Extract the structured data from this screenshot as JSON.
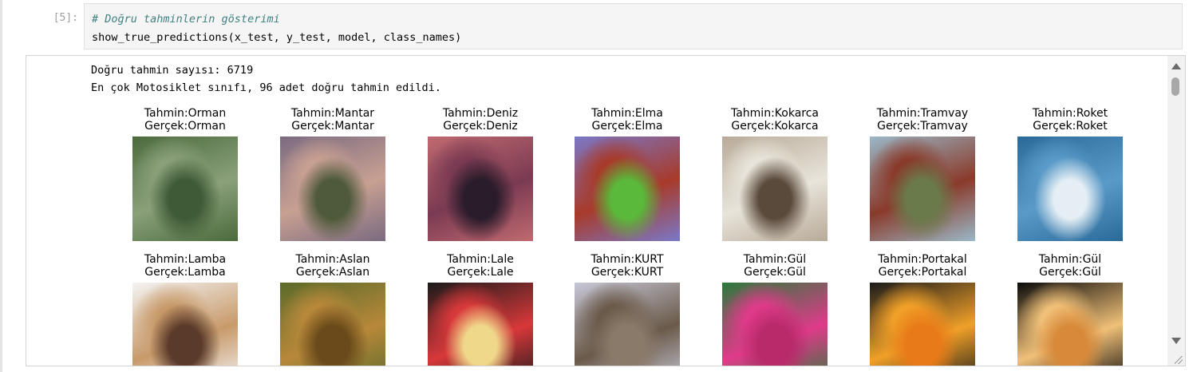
{
  "cell": {
    "prompt": "[5]:",
    "code_comment": "# Doğru tahminlerin gösterimi",
    "code_call": "show_true_predictions(x_test, y_test, model, class_names)"
  },
  "output": {
    "line1": "Doğru tahmin sayısı: 6719",
    "line2": "En çok Motosiklet sınıfı, 96 adet doğru tahmin edildi."
  },
  "predictions": [
    {
      "pred": "Tahmin:Orman",
      "true": "Gerçek:Orman",
      "colors": [
        "#4a6a3c",
        "#8aa07a",
        "#3e5a36"
      ]
    },
    {
      "pred": "Tahmin:Mantar",
      "true": "Gerçek:Mantar",
      "colors": [
        "#7a6a80",
        "#c8a092",
        "#4e5a3a"
      ]
    },
    {
      "pred": "Tahmin:Deniz",
      "true": "Gerçek:Deniz",
      "colors": [
        "#c06a70",
        "#7a3a52",
        "#2a1c2a"
      ]
    },
    {
      "pred": "Tahmin:Elma",
      "true": "Gerçek:Elma",
      "colors": [
        "#7a78c8",
        "#a83a2a",
        "#5ab83a"
      ]
    },
    {
      "pred": "Tahmin:Kokarca",
      "true": "Gerçek:Kokarca",
      "colors": [
        "#b8aa98",
        "#e8e4da",
        "#5a4a3c"
      ]
    },
    {
      "pred": "Tahmin:Tramvay",
      "true": "Gerçek:Tramvay",
      "colors": [
        "#9ab8c8",
        "#8a3a2a",
        "#6a7a4a"
      ]
    },
    {
      "pred": "Tahmin:Roket",
      "true": "Gerçek:Roket",
      "colors": [
        "#2a6a98",
        "#5a9ac8",
        "#e4eef4"
      ]
    },
    {
      "pred": "Tahmin:Lamba",
      "true": "Gerçek:Lamba",
      "colors": [
        "#f4f4f4",
        "#c89a6a",
        "#5a3a2a"
      ]
    },
    {
      "pred": "Tahmin:Aslan",
      "true": "Gerçek:Aslan",
      "colors": [
        "#5a6a2a",
        "#b8883a",
        "#6a4a1a"
      ]
    },
    {
      "pred": "Tahmin:Lale",
      "true": "Gerçek:Lale",
      "colors": [
        "#1a1a1a",
        "#d8383a",
        "#f0d88a"
      ]
    },
    {
      "pred": "Tahmin:KURT",
      "true": "Gerçek:KURT",
      "colors": [
        "#c8c8d8",
        "#6a5a4a",
        "#8a7a6a"
      ]
    },
    {
      "pred": "Tahmin:Gül",
      "true": "Gerçek:Gül",
      "colors": [
        "#2a7a3a",
        "#e03a8a",
        "#b82a6a"
      ]
    },
    {
      "pred": "Tahmin:Portakal",
      "true": "Gerçek:Portakal",
      "colors": [
        "#1a1a1a",
        "#f0a028",
        "#e87a18"
      ]
    },
    {
      "pred": "Tahmin:Gül",
      "true": "Gerçek:Gül",
      "colors": [
        "#0a0a0a",
        "#f0c078",
        "#d88a3a"
      ]
    }
  ]
}
